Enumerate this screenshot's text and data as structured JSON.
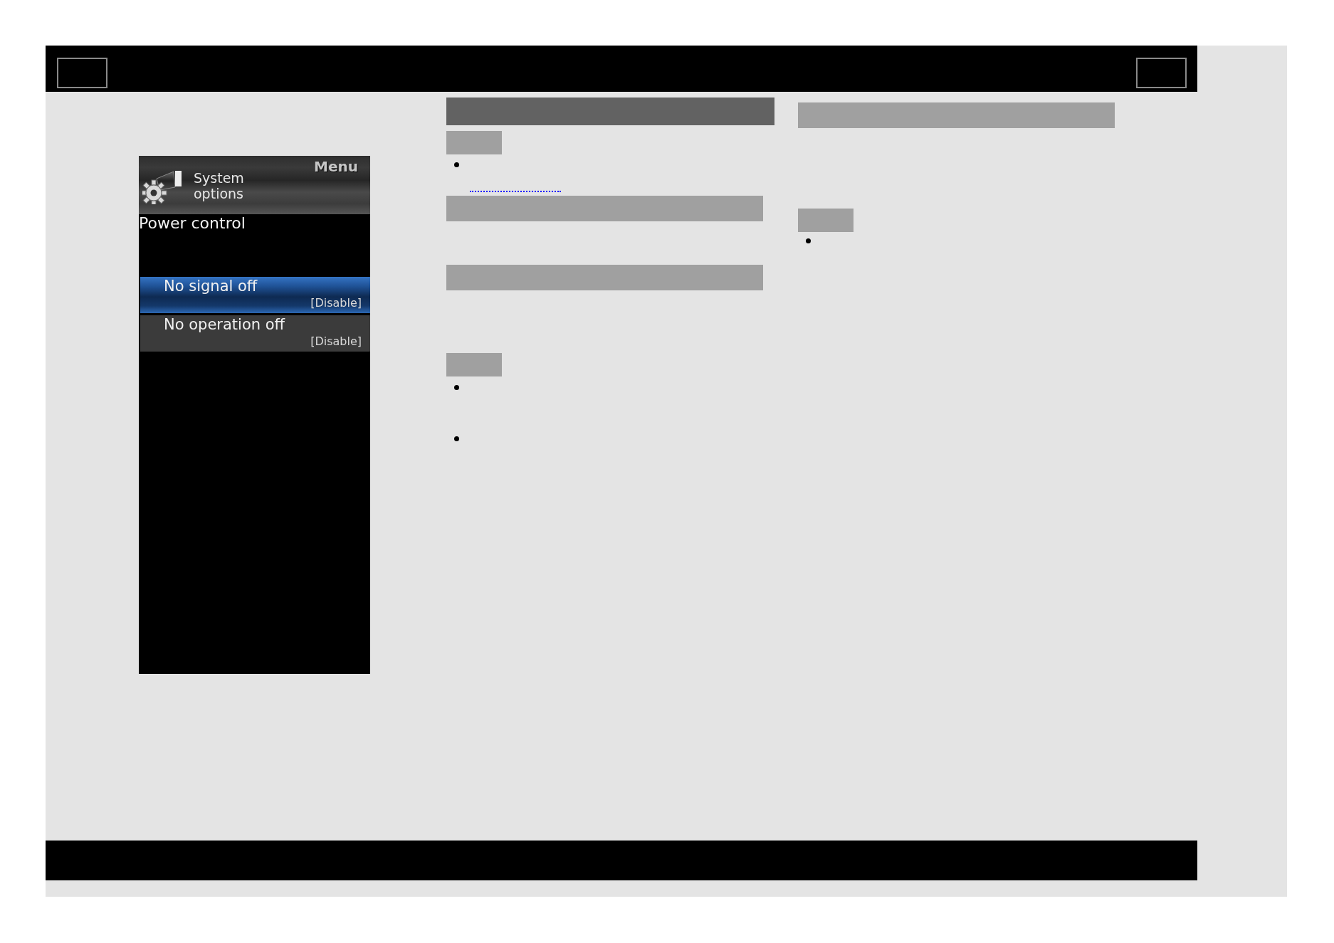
{
  "menu": {
    "title": "Menu",
    "category": "System options",
    "heading": "Power control",
    "items": [
      {
        "label": "No signal off",
        "value": "[Disable]",
        "selected": true
      },
      {
        "label": "No operation off",
        "value": "[Disable]",
        "selected": false
      }
    ]
  },
  "columns": [
    {
      "blocks": [
        {
          "kind": "title"
        },
        {
          "kind": "tag"
        },
        {
          "kind": "bullet"
        },
        {
          "kind": "link"
        },
        {
          "kind": "heading"
        },
        {
          "kind": "heading"
        },
        {
          "kind": "tag"
        },
        {
          "kind": "bullet"
        },
        {
          "kind": "bullet"
        }
      ]
    },
    {
      "blocks": [
        {
          "kind": "heading"
        },
        {
          "kind": "tag"
        },
        {
          "kind": "bullet"
        }
      ]
    }
  ]
}
